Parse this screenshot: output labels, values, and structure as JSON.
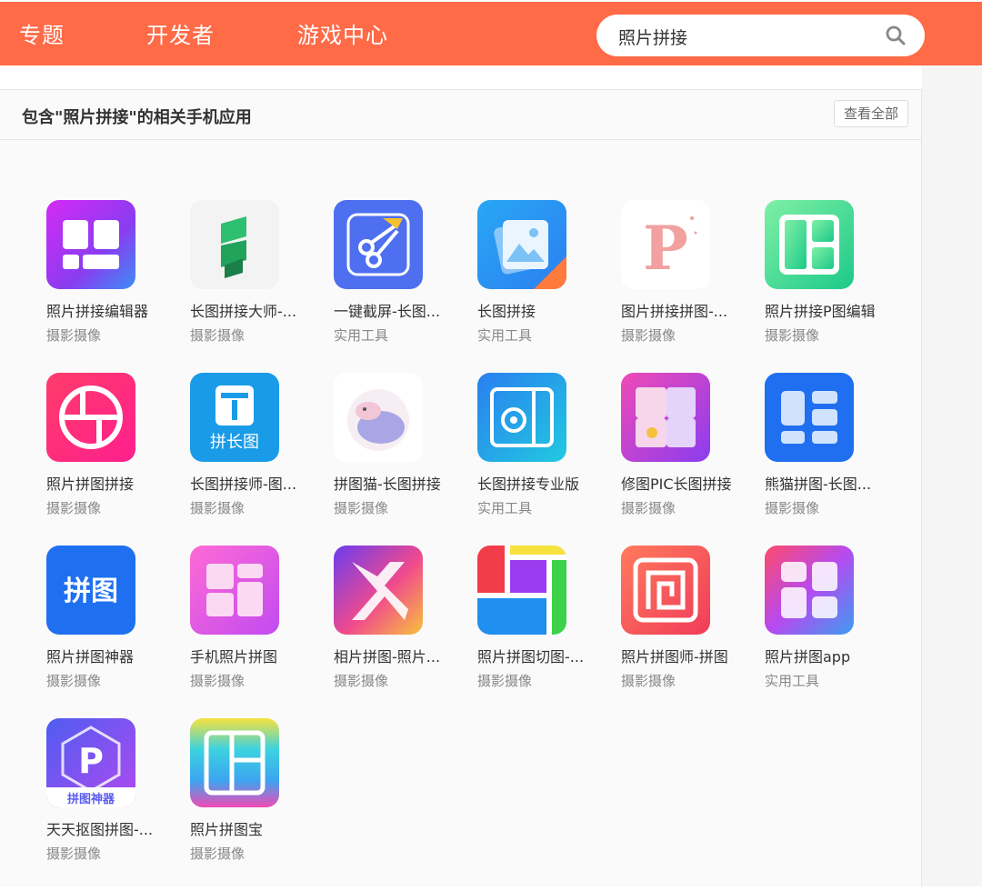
{
  "nav": {
    "items": [
      "专题",
      "开发者",
      "游戏中心"
    ]
  },
  "search": {
    "value": "照片拼接"
  },
  "section": {
    "title": "包含\"照片拼接\"的相关手机应用",
    "view_all": "查看全部"
  },
  "apps": [
    {
      "name": "照片拼接编辑器",
      "category": "摄影摄像",
      "icon": "photo-collage-grid-icon"
    },
    {
      "name": "长图拼接大师-...",
      "category": "摄影摄像",
      "icon": "green-s-logo-icon"
    },
    {
      "name": "一键截屏-长图...",
      "category": "实用工具",
      "icon": "scissors-icon"
    },
    {
      "name": "长图拼接",
      "category": "实用工具",
      "icon": "image-stack-icon"
    },
    {
      "name": "图片拼接拼图-...",
      "category": "摄影摄像",
      "icon": "letter-p-icon"
    },
    {
      "name": "照片拼接P图编辑",
      "category": "摄影摄像",
      "icon": "green-grid-icon"
    },
    {
      "name": "照片拼图拼接",
      "category": "摄影摄像",
      "icon": "circle-grid-icon"
    },
    {
      "name": "长图拼接师-图...",
      "category": "摄影摄像",
      "icon": "long-image-icon"
    },
    {
      "name": "拼图猫-长图拼接",
      "category": "摄影摄像",
      "icon": "cat-icon"
    },
    {
      "name": "长图拼接专业版",
      "category": "实用工具",
      "icon": "camera-frame-icon"
    },
    {
      "name": "修图PIC长图拼接",
      "category": "摄影摄像",
      "icon": "puzzle-icon"
    },
    {
      "name": "熊猫拼图-长图...",
      "category": "摄影摄像",
      "icon": "panda-layout-icon"
    },
    {
      "name": "照片拼图神器",
      "category": "摄影摄像",
      "icon": "pintu-text-icon"
    },
    {
      "name": "手机照片拼图",
      "category": "摄影摄像",
      "icon": "pink-grid-icon"
    },
    {
      "name": "相片拼图-照片...",
      "category": "摄影摄像",
      "icon": "x-shape-icon"
    },
    {
      "name": "照片拼图切图-...",
      "category": "摄影摄像",
      "icon": "color-blocks-icon"
    },
    {
      "name": "照片拼图师-拼图",
      "category": "摄影摄像",
      "icon": "spiral-frame-icon"
    },
    {
      "name": "照片拼图app",
      "category": "实用工具",
      "icon": "gradient-grid-icon"
    },
    {
      "name": "天天抠图拼图-...",
      "category": "摄影摄像",
      "icon": "hexagon-p-icon"
    },
    {
      "name": "照片拼图宝",
      "category": "摄影摄像",
      "icon": "rainbow-frame-icon"
    }
  ],
  "icon_texts": {
    "pintu": "拼图",
    "pinchangtu": "拼长图",
    "pintushenqi": "拼图神器",
    "p": "P"
  },
  "colors": {
    "accent": "#ff6a47"
  }
}
